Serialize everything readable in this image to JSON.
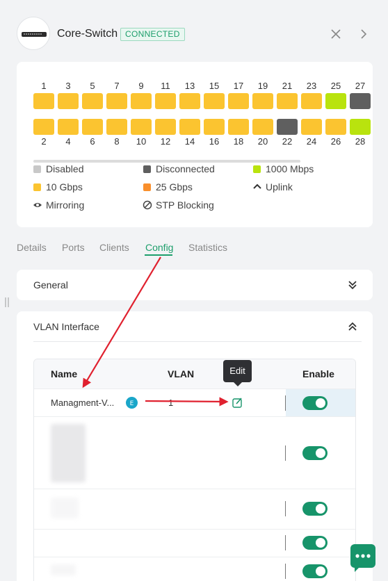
{
  "header": {
    "device_name": "Core-Switch",
    "status": "CONNECTED",
    "icons": [
      "switch-device-icon",
      "close-icon",
      "chevron-right-icon"
    ]
  },
  "ports": {
    "top_row": [
      {
        "num": "1",
        "state": "10 Gbps"
      },
      {
        "num": "3",
        "state": "10 Gbps"
      },
      {
        "num": "5",
        "state": "10 Gbps"
      },
      {
        "num": "7",
        "state": "10 Gbps"
      },
      {
        "num": "9",
        "state": "10 Gbps"
      },
      {
        "num": "11",
        "state": "10 Gbps"
      },
      {
        "num": "13",
        "state": "10 Gbps"
      },
      {
        "num": "15",
        "state": "10 Gbps"
      },
      {
        "num": "17",
        "state": "10 Gbps"
      },
      {
        "num": "19",
        "state": "10 Gbps"
      },
      {
        "num": "21",
        "state": "10 Gbps"
      },
      {
        "num": "23",
        "state": "10 Gbps"
      },
      {
        "num": "25",
        "state": "1000 Mbps"
      },
      {
        "num": "27",
        "state": "Disconnected"
      }
    ],
    "bottom_row": [
      {
        "num": "2",
        "state": "10 Gbps"
      },
      {
        "num": "4",
        "state": "10 Gbps"
      },
      {
        "num": "6",
        "state": "10 Gbps"
      },
      {
        "num": "8",
        "state": "10 Gbps"
      },
      {
        "num": "10",
        "state": "10 Gbps"
      },
      {
        "num": "12",
        "state": "10 Gbps"
      },
      {
        "num": "14",
        "state": "10 Gbps"
      },
      {
        "num": "16",
        "state": "10 Gbps"
      },
      {
        "num": "18",
        "state": "10 Gbps"
      },
      {
        "num": "20",
        "state": "10 Gbps"
      },
      {
        "num": "22",
        "state": "Disconnected"
      },
      {
        "num": "24",
        "state": "10 Gbps"
      },
      {
        "num": "26",
        "state": "10 Gbps"
      },
      {
        "num": "28",
        "state": "1000 Mbps"
      }
    ]
  },
  "legend": {
    "disabled": "Disabled",
    "disconnected": "Disconnected",
    "mbps1000": "1000 Mbps",
    "gbps10": "10 Gbps",
    "gbps25": "25 Gbps",
    "uplink": "Uplink",
    "mirroring": "Mirroring",
    "stp_blocking": "STP Blocking"
  },
  "colors": {
    "disabled": "#c8c8c8",
    "disconnected": "#5f5f5f",
    "mbps1000": "#b9e30e",
    "gbps10": "#fbc430",
    "gbps25": "#f98f2c",
    "accent": "#1d9e6b"
  },
  "tabs": [
    {
      "label": "Details",
      "active": false
    },
    {
      "label": "Ports",
      "active": false
    },
    {
      "label": "Clients",
      "active": false
    },
    {
      "label": "Config",
      "active": true
    },
    {
      "label": "Statistics",
      "active": false
    }
  ],
  "sections": {
    "general": {
      "title": "General",
      "expanded": false
    },
    "vlan_interface": {
      "title": "VLAN Interface",
      "expanded": true
    }
  },
  "table": {
    "headers": {
      "name": "Name",
      "vlan": "VLAN",
      "enable": "Enable"
    },
    "rows": [
      {
        "name": "Managment-V...",
        "vlan": "1",
        "enabled": true,
        "badge_icon": "management-icon",
        "edit_icon": "edit-icon"
      },
      {
        "name": "",
        "vlan": "",
        "enabled": true
      },
      {
        "name": "",
        "vlan": "",
        "enabled": true
      },
      {
        "name": "",
        "vlan": "",
        "enabled": true
      },
      {
        "name": "",
        "vlan": "",
        "enabled": true
      }
    ]
  },
  "tooltip": {
    "text": "Edit"
  },
  "chat": {
    "icon": "chat-icon"
  }
}
